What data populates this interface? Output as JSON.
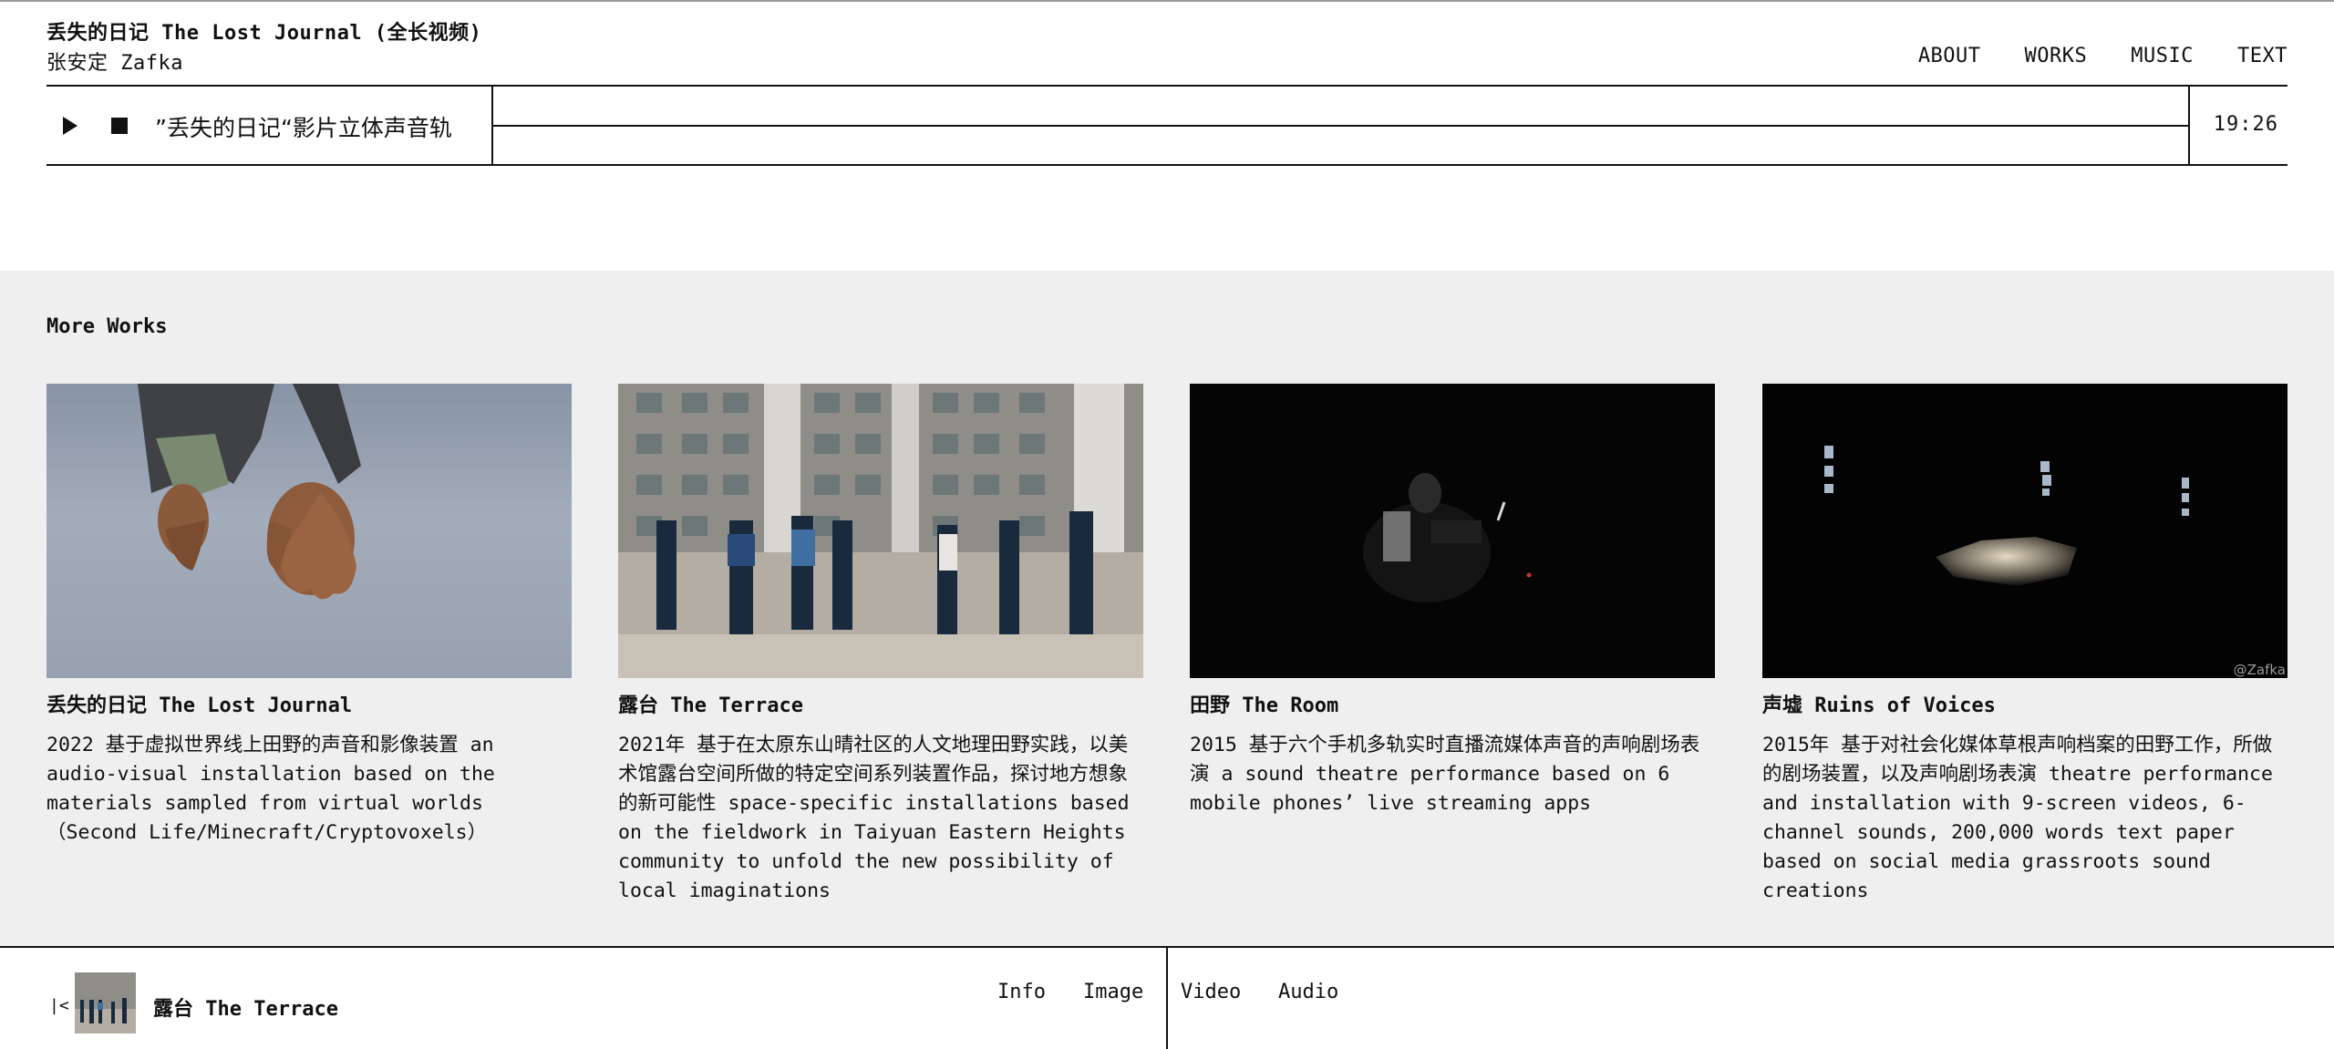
{
  "header": {
    "title": "丢失的日记 The Lost Journal (全长视频)",
    "author": "张安定 Zafka",
    "nav": [
      "ABOUT",
      "WORKS",
      "MUSIC",
      "TEXT"
    ]
  },
  "player": {
    "track_title": "”丢失的日记“影片立体声音轨",
    "duration": "19:26"
  },
  "more_works": {
    "heading": "More Works",
    "cards": [
      {
        "title": "丢失的日记 The Lost Journal",
        "description": "2022 基于虚拟世界线上田野的声音和影像装置 an audio-visual installation based on the materials sampled from virtual worlds （Second Life/Minecraft/Cryptovoxels）"
      },
      {
        "title": "露台 The Terrace",
        "description": "2021年 基于在太原东山晴社区的人文地理田野实践，以美术馆露台空间所做的特定空间系列装置作品，探讨地方想象的新可能性 space-specific installations based on the fieldwork in Taiyuan Eastern Heights community to unfold the new possibility of local imaginations"
      },
      {
        "title": "田野 The Room",
        "description": "2015 基于六个手机多轨实时直播流媒体声音的声响剧场表演 a sound theatre performance based on 6 mobile phones’ live streaming apps"
      },
      {
        "title": "声墟 Ruins of Voices",
        "description": "2015年 基于对社会化媒体草根声响档案的田野工作，所做的剧场装置，以及声响剧场表演 theatre performance and installation with 9-screen videos, 6-channel sounds, 200,000 words text paper based on social media grassroots sound creations",
        "watermark": "@Zafka"
      }
    ]
  },
  "bottombar": {
    "current_title": "露台 The Terrace",
    "tabs_left": [
      "Info",
      "Image"
    ],
    "tabs_right": [
      "Video",
      "Audio"
    ]
  }
}
